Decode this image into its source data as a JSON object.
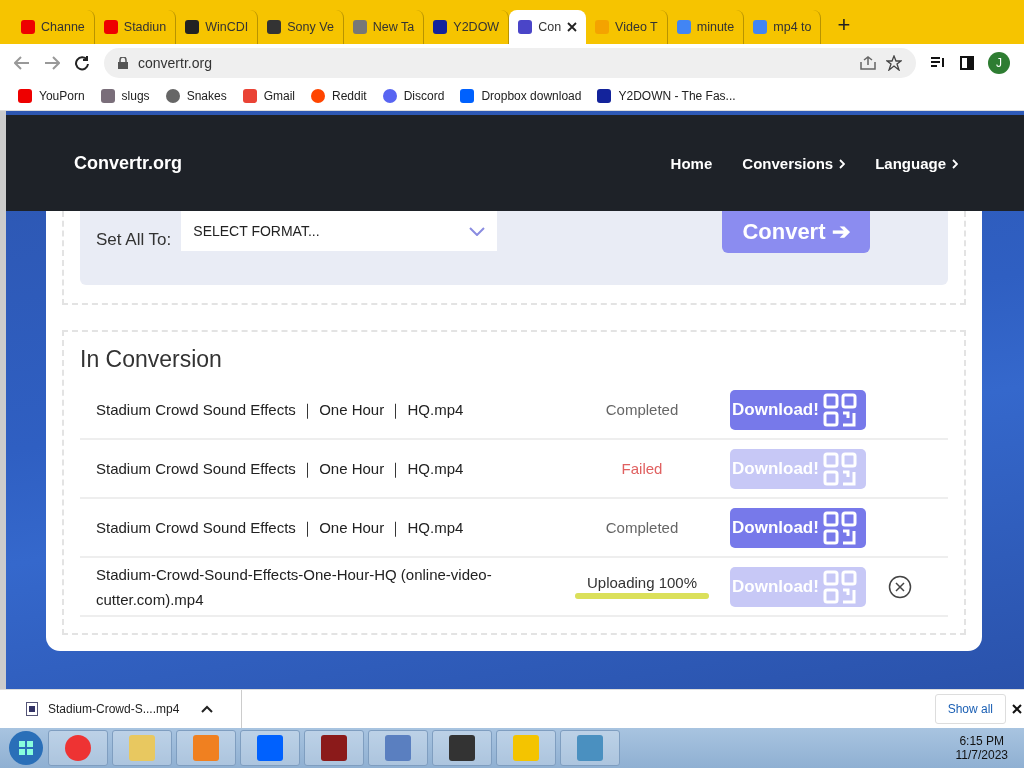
{
  "tabs": [
    {
      "title": "Channe",
      "selected": false
    },
    {
      "title": "Stadiun",
      "selected": false
    },
    {
      "title": "WinCDI",
      "selected": false
    },
    {
      "title": "Sony Ve",
      "selected": false
    },
    {
      "title": "New Ta",
      "selected": false
    },
    {
      "title": "Y2DOW",
      "selected": false
    },
    {
      "title": "Con",
      "selected": true
    },
    {
      "title": "Video T",
      "selected": false
    },
    {
      "title": "minute",
      "selected": false
    },
    {
      "title": "mp4 to",
      "selected": false
    }
  ],
  "new_tab": "+",
  "address": "convertr.org",
  "avatar": "J",
  "bookmarks": [
    "YouPorn",
    "slugs",
    "Snakes",
    "Gmail",
    "Reddit",
    "Discord",
    "Dropbox download",
    "Y2DOWN - The Fas..."
  ],
  "site": {
    "logo": "Convertr.org",
    "nav": [
      "Home",
      "Conversions",
      "Language"
    ]
  },
  "settings": {
    "label": "Set All To:",
    "select": "SELECT FORMAT...",
    "convert": "Convert ➔"
  },
  "conversion": {
    "title": "In Conversion",
    "rows": [
      {
        "name": "Stadium Crowd Sound Effects ｜ One Hour ｜ HQ.mp4",
        "status": "Completed",
        "kind": "completed",
        "download": "Download!",
        "disabled": false
      },
      {
        "name": "Stadium Crowd Sound Effects ｜ One Hour ｜ HQ.mp4",
        "status": "Failed",
        "kind": "failed",
        "download": "Download!",
        "disabled": true
      },
      {
        "name": "Stadium Crowd Sound Effects ｜ One Hour ｜ HQ.mp4",
        "status": "Completed",
        "kind": "completed",
        "download": "Download!",
        "disabled": false
      },
      {
        "name": "Stadium-Crowd-Sound-Effects-One-Hour-HQ (online-video-cutter.com).mp4",
        "status": "Uploading 100%",
        "kind": "uploading",
        "level": 1,
        "download": "Download!",
        "disabled": true
      }
    ]
  },
  "download_shelf": {
    "file": "Stadium-Crowd-S....mp4",
    "show_all": "Show all"
  },
  "taskbar": {
    "time": "6:15 PM",
    "date": "11/7/2023"
  }
}
